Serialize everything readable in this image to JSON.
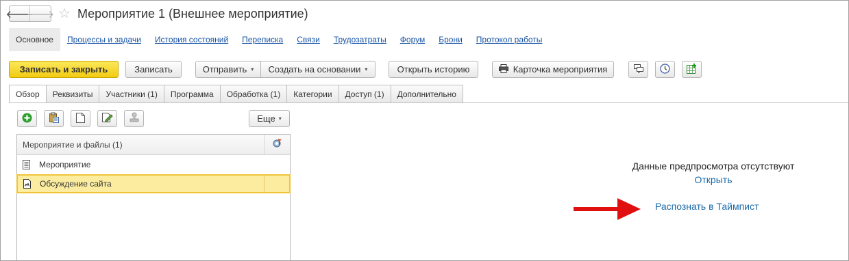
{
  "window": {
    "title": "Мероприятие 1  (Внешнее мероприятие)",
    "back_glyph": "🡐",
    "forward_glyph": "🡒",
    "star_glyph": "☆"
  },
  "sections": [
    {
      "label": "Основное",
      "active": true
    },
    {
      "label": "Процессы и задачи"
    },
    {
      "label": "История состояний"
    },
    {
      "label": "Переписка"
    },
    {
      "label": "Связи"
    },
    {
      "label": "Трудозатраты"
    },
    {
      "label": "Форум"
    },
    {
      "label": "Брони"
    },
    {
      "label": "Протокол работы"
    }
  ],
  "commands": {
    "save_close": "Записать и закрыть",
    "save": "Записать",
    "send": "Отправить",
    "create_based": "Создать на основании",
    "open_history": "Открыть историю",
    "event_card": "Карточка мероприятия",
    "caret": "▾"
  },
  "tabs": [
    {
      "label": "Обзор",
      "active": true
    },
    {
      "label": "Реквизиты"
    },
    {
      "label": "Участники (1)"
    },
    {
      "label": "Программа"
    },
    {
      "label": "Обработка (1)"
    },
    {
      "label": "Категории"
    },
    {
      "label": "Доступ (1)"
    },
    {
      "label": "Дополнительно"
    }
  ],
  "panel": {
    "more": "Еще",
    "list_header": "Мероприятие и файлы (1)",
    "rows": [
      {
        "label": "Мероприятие",
        "selected": false
      },
      {
        "label": "Обсуждение сайта",
        "selected": true
      }
    ]
  },
  "preview": {
    "message": "Данные предпросмотра отсутствуют",
    "open": "Открыть",
    "recognize": "Распознать в Таймпист"
  },
  "colors": {
    "primary_button": "#f2cb12",
    "link": "#1a6aa8",
    "selection": "#fbeca0",
    "arrow": "#e01010"
  }
}
